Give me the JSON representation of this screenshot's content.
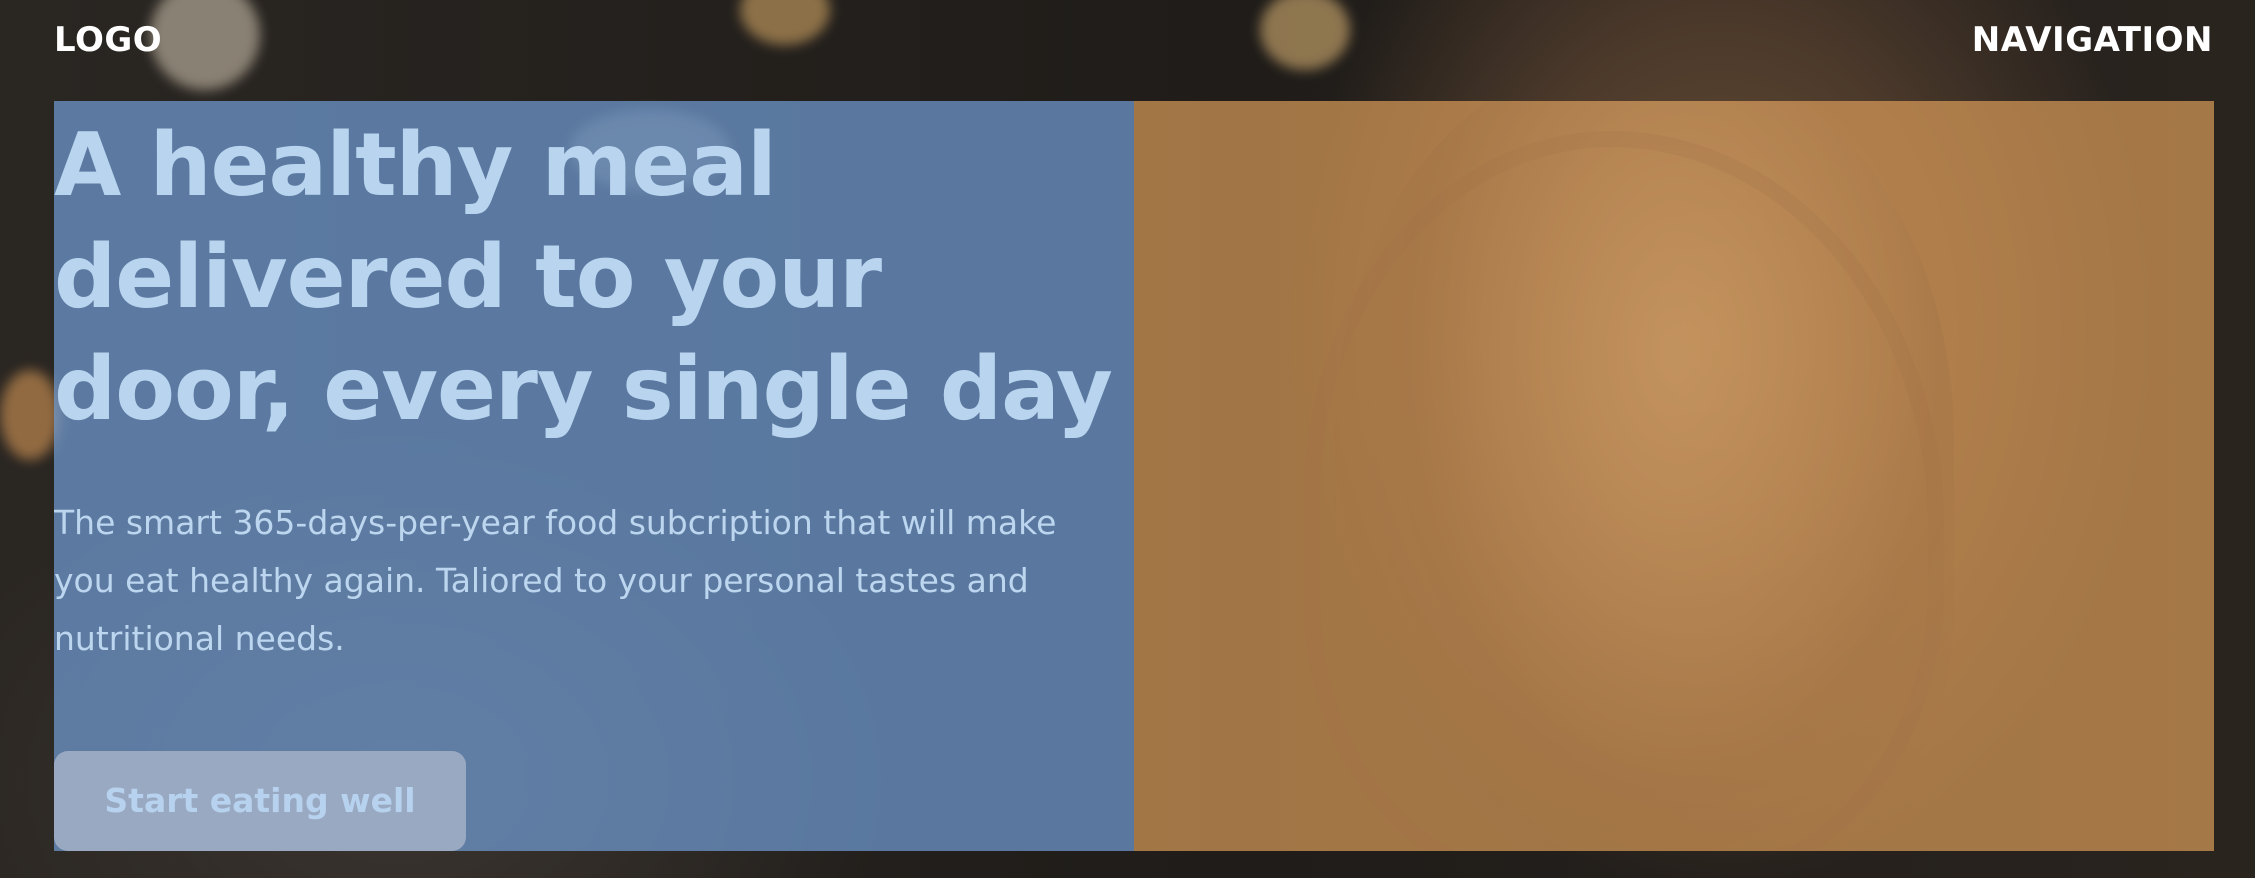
{
  "header": {
    "logo": "LOGO",
    "navigation": "NAVIGATION"
  },
  "hero": {
    "headline": "A healthy meal delivered to your door, every single day",
    "description": "The smart 365-days-per-year food subcription that will make you eat healthy again. Taliored to your personal tastes and nutritional needs.",
    "cta_label": "Start eating well"
  },
  "colors": {
    "left_panel": "#709bd2",
    "right_panel": "#d69957",
    "headline": "#b8d4ef",
    "header_text": "#ffffff",
    "button": "#a0acc4"
  }
}
